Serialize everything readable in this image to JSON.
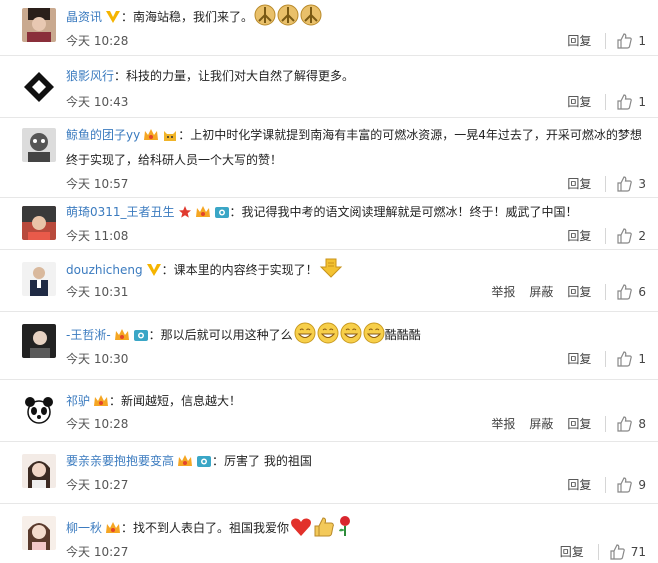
{
  "like_icon_color": "#888888",
  "user_color": "#3b7bbf",
  "comments": [
    {
      "user": "晶资讯",
      "badges": [
        "v-badge"
      ],
      "text": "：南海站稳，我们来了。",
      "emojis": [
        "peace-emoji",
        "peace-emoji",
        "peace-emoji"
      ],
      "time": "今天 10:28",
      "report": "",
      "block": "",
      "reply": "回复",
      "likes": "1"
    },
    {
      "user": "狼影风行",
      "badges": [],
      "text": "：科技的力量，让我们对大自然了解得更多。",
      "emojis": [],
      "time": "今天 10:43",
      "report": "",
      "block": "",
      "reply": "回复",
      "likes": "1"
    },
    {
      "user": "鲸鱼的团子yy",
      "badges": [
        "member-badge",
        "cat-badge"
      ],
      "text": "：上初中时化学课就提到南海有丰富的可燃冰资源，一晃4年过去了，开采可燃冰的梦想终于实现了，给科研人员一个大写的赞！",
      "emojis": [],
      "time": "今天 10:57",
      "report": "",
      "block": "",
      "reply": "回复",
      "likes": "3"
    },
    {
      "user": "萌琦0311_王者丑生",
      "badges": [
        "star-badge",
        "member-badge",
        "camera-badge"
      ],
      "text": "：我记得我中考的语文阅读理解就是可燃冰！终于！威武了中国！",
      "emojis": [],
      "time": "今天 11:08",
      "report": "",
      "block": "",
      "reply": "回复",
      "likes": "2"
    },
    {
      "user": "douzhicheng",
      "badges": [
        "v-badge"
      ],
      "text": "：课本里的内容终于实现了！",
      "emojis": [
        "down-arrow-emoji"
      ],
      "time": "今天 10:31",
      "report": "举报",
      "block": "屏蔽",
      "reply": "回复",
      "likes": "6"
    },
    {
      "user": "-王哲淅-",
      "badges": [
        "member-badge",
        "camera-badge"
      ],
      "text": "：那以后就可以用这种了么",
      "emojis": [
        "grin-emoji",
        "grin-emoji",
        "grin-emoji",
        "grin-emoji"
      ],
      "trailing": "酷酷酷",
      "time": "今天 10:30",
      "report": "",
      "block": "",
      "reply": "回复",
      "likes": "1"
    },
    {
      "user": "祁驴",
      "badges": [
        "member-badge"
      ],
      "text": "：新闻越短，信息越大！",
      "emojis": [],
      "time": "今天 10:28",
      "report": "举报",
      "block": "屏蔽",
      "reply": "回复",
      "likes": "8"
    },
    {
      "user": "要亲亲要抱抱要变高",
      "badges": [
        "member-badge",
        "camera-badge"
      ],
      "text": "：厉害了 我的祖国",
      "emojis": [],
      "time": "今天 10:27",
      "report": "",
      "block": "",
      "reply": "回复",
      "likes": "9"
    },
    {
      "user": "柳一秋",
      "badges": [
        "member-badge"
      ],
      "text": "：找不到人表白了。祖国我爱你",
      "emojis": [
        "heart-emoji",
        "thumbs-up-emoji",
        "rose-emoji"
      ],
      "time": "今天 10:27",
      "report": "",
      "block": "",
      "reply": "回复",
      "likes": "71"
    }
  ]
}
